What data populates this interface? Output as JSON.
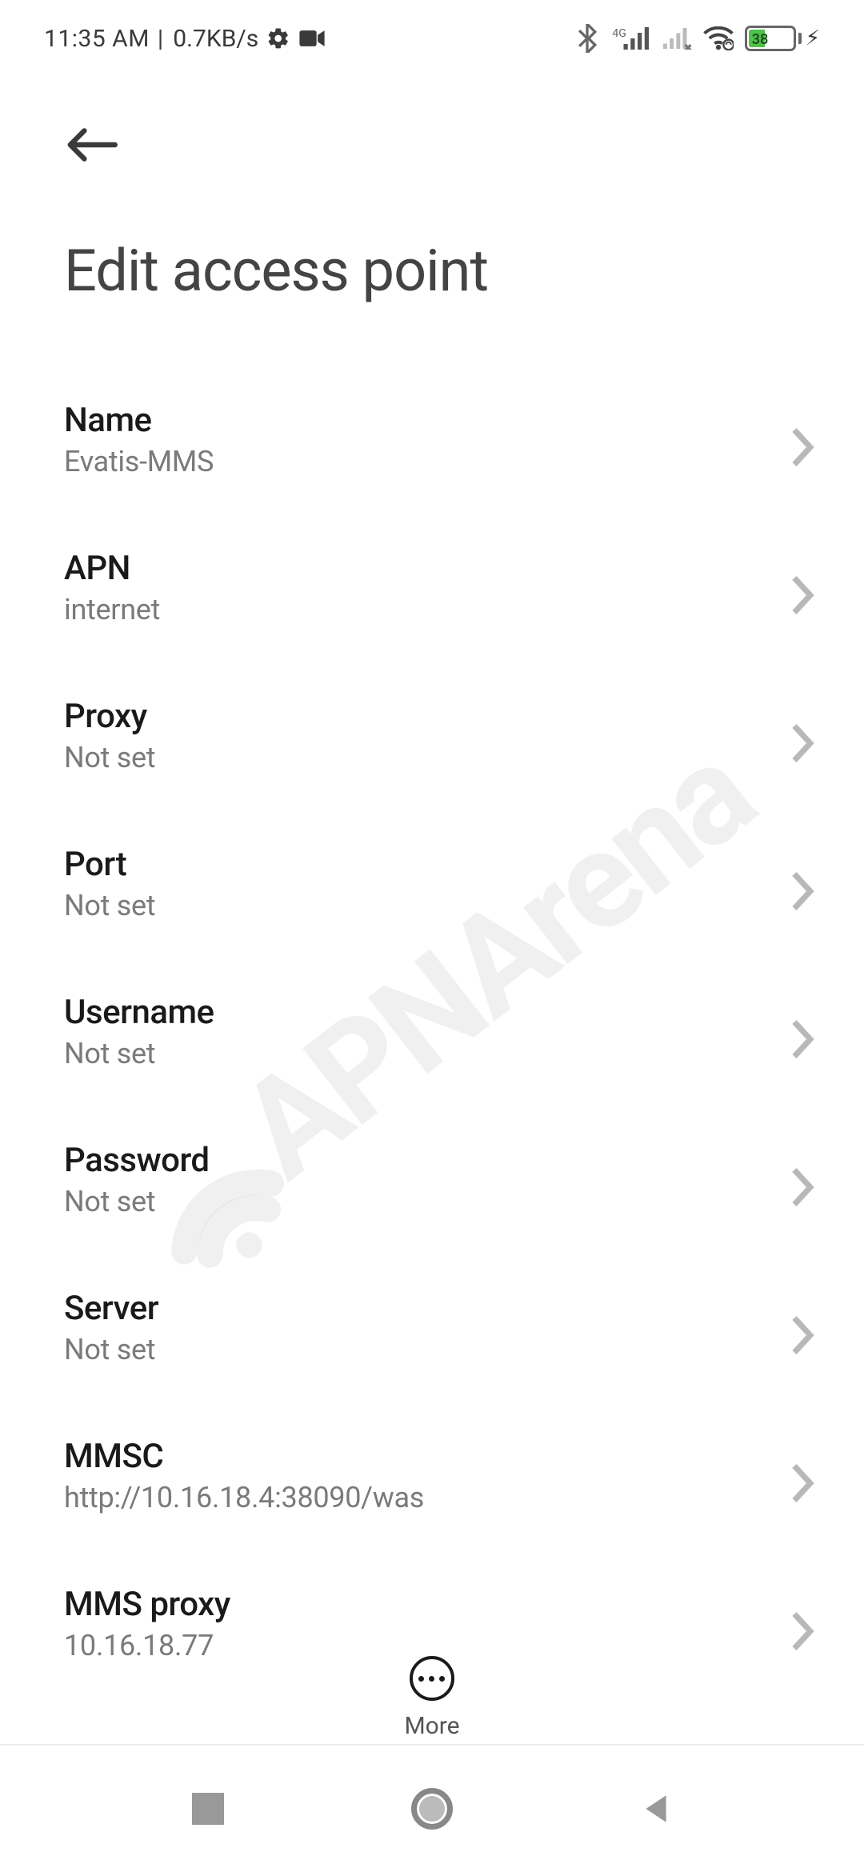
{
  "statusbar": {
    "time": "11:35 AM",
    "separator": " | ",
    "speed": "0.7KB/s",
    "net_badge": "4G",
    "battery_pct": "38"
  },
  "header": {
    "title": "Edit access point"
  },
  "settings": [
    {
      "label": "Name",
      "value": "Evatis-MMS"
    },
    {
      "label": "APN",
      "value": "internet"
    },
    {
      "label": "Proxy",
      "value": "Not set"
    },
    {
      "label": "Port",
      "value": "Not set"
    },
    {
      "label": "Username",
      "value": "Not set"
    },
    {
      "label": "Password",
      "value": "Not set"
    },
    {
      "label": "Server",
      "value": "Not set"
    },
    {
      "label": "MMSC",
      "value": "http://10.16.18.4:38090/was"
    },
    {
      "label": "MMS proxy",
      "value": "10.16.18.77"
    }
  ],
  "bottom": {
    "more_label": "More"
  },
  "watermark": {
    "text": "APNArena"
  }
}
